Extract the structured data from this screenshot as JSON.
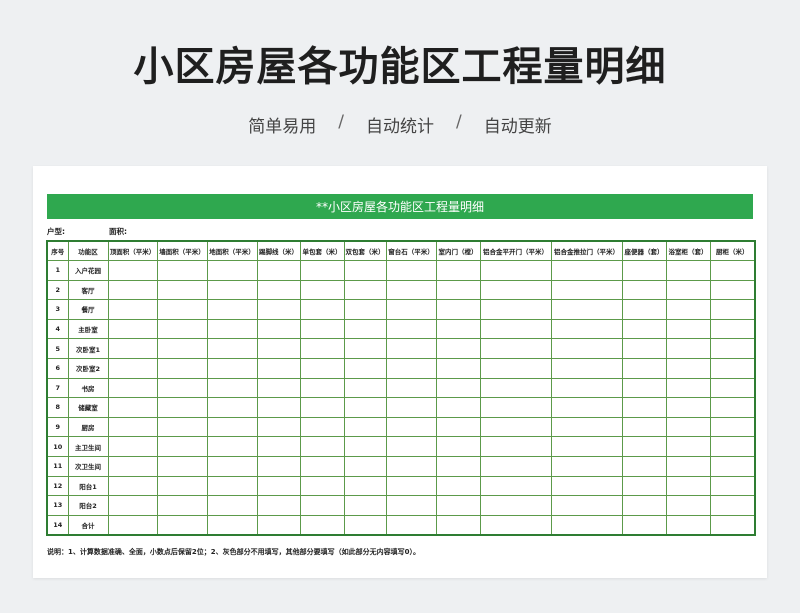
{
  "header": {
    "title": "小区房屋各功能区工程量明细",
    "tags": [
      "简单易用",
      "自动统计",
      "自动更新"
    ],
    "separator": "/"
  },
  "sheet": {
    "banner": "**小区房屋各功能区工程量明细",
    "meta": {
      "house_type_label": "户型:",
      "area_label": "面积:"
    },
    "columns": [
      "序号",
      "功能区",
      "顶面积（平米）",
      "墙面积（平米）",
      "地面积（平米）",
      "踢脚线（米）",
      "单包套（米）",
      "双包套（米）",
      "窗台石（平米）",
      "室内门（樘）",
      "铝合金平开门（平米）",
      "铝合金推拉门（平米）",
      "座便器（套）",
      "浴室柜（套）",
      "厨柜（米）"
    ],
    "rows": [
      {
        "no": "1",
        "area": "入户花园"
      },
      {
        "no": "2",
        "area": "客厅"
      },
      {
        "no": "3",
        "area": "餐厅"
      },
      {
        "no": "4",
        "area": "主卧室"
      },
      {
        "no": "5",
        "area": "次卧室1"
      },
      {
        "no": "6",
        "area": "次卧室2"
      },
      {
        "no": "7",
        "area": "书房"
      },
      {
        "no": "8",
        "area": "储藏室"
      },
      {
        "no": "9",
        "area": "厨房"
      },
      {
        "no": "10",
        "area": "主卫生间"
      },
      {
        "no": "11",
        "area": "次卫生间"
      },
      {
        "no": "12",
        "area": "阳台1"
      },
      {
        "no": "13",
        "area": "阳台2"
      },
      {
        "no": "14",
        "area": "合计"
      }
    ],
    "note": "说明：1、计算数据准确、全面，小数点后保留2位；2、灰色部分不用填写，其他部分要填写（如此部分无内容填写0）。"
  },
  "colors": {
    "banner": "#2fa84f",
    "grid_border": "#5c9a4a",
    "background": "#eef0f2"
  }
}
